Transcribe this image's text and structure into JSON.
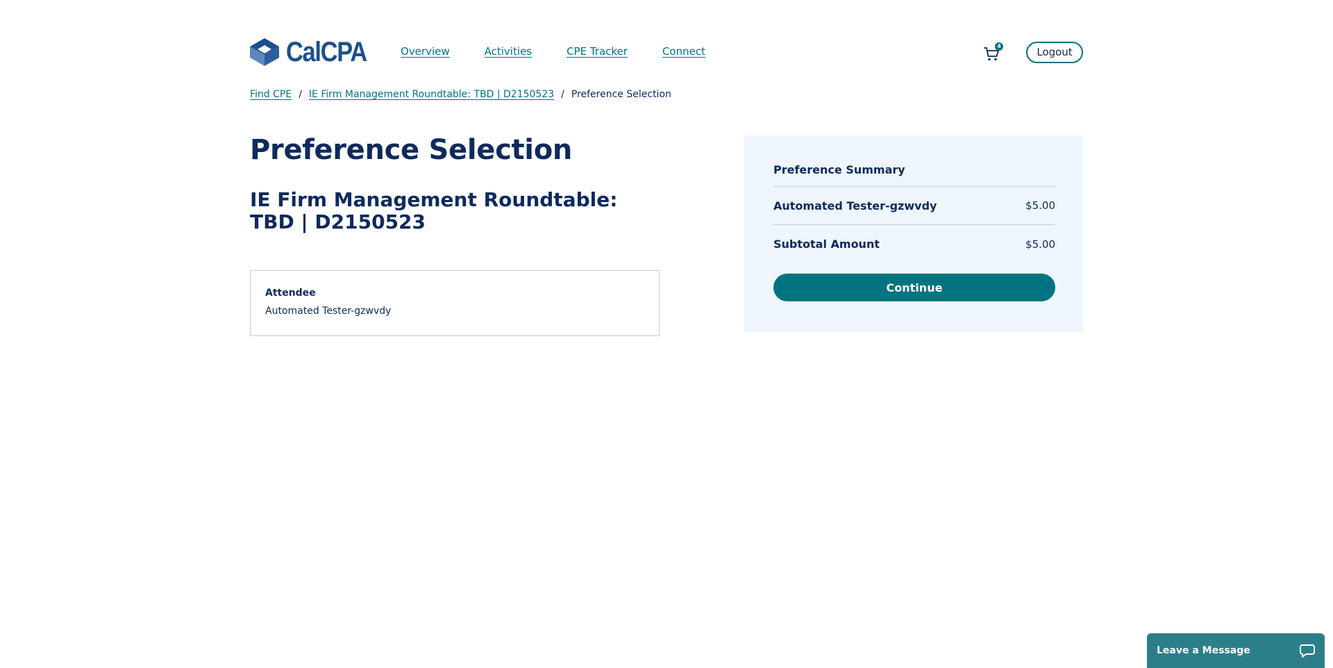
{
  "header": {
    "logo_text": "CalCPA",
    "nav": [
      {
        "label": "Overview"
      },
      {
        "label": "Activities"
      },
      {
        "label": "CPE Tracker"
      },
      {
        "label": "Connect"
      }
    ],
    "cart_count": "4",
    "logout_label": "Logout"
  },
  "breadcrumb": {
    "items": [
      {
        "label": "Find CPE"
      },
      {
        "label": "IE Firm Management Roundtable: TBD | D2150523"
      }
    ],
    "separator": "/",
    "current": "Preference Selection"
  },
  "main": {
    "page_title": "Preference Selection",
    "event_title": "IE Firm Management Roundtable: TBD | D2150523",
    "attendee": {
      "label": "Attendee",
      "name": "Automated Tester-gzwvdy"
    }
  },
  "summary": {
    "heading": "Preference Summary",
    "line_item": {
      "label": "Automated Tester-gzwvdy",
      "amount": "$5.00"
    },
    "subtotal": {
      "label": "Subtotal Amount",
      "amount": "$5.00"
    },
    "continue_label": "Continue"
  },
  "chat": {
    "label": "Leave a Message"
  },
  "colors": {
    "brand_teal": "#007481",
    "navy_text": "#0e2a5c",
    "logo_blue": "#1d4f8e",
    "summary_bg": "#eef5fd",
    "chat_bg": "#2c7f8a"
  }
}
